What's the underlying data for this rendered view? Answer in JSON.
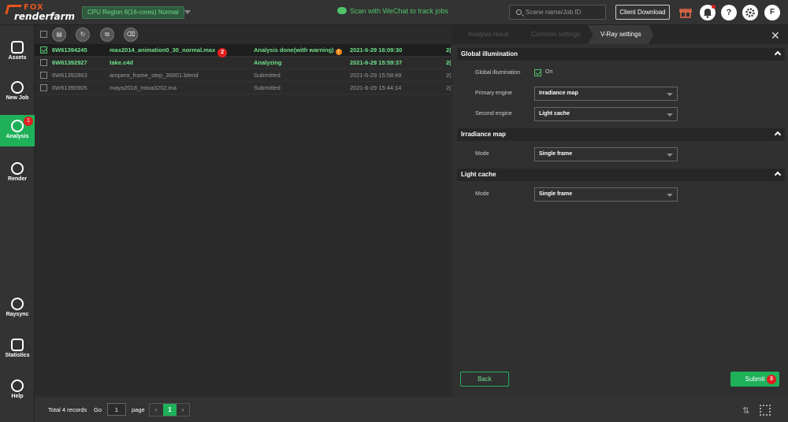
{
  "header": {
    "logo_top": "FOX",
    "logo_bottom": "renderfarm",
    "region": "CPU Region 6(16-cores)   Normal",
    "wechat": "Scan with WeChat to track jobs",
    "search_placeholder": "Scene name/Job ID",
    "client_download": "Client Download",
    "avatar": "F",
    "help": "?"
  },
  "sidebar": {
    "items": [
      {
        "label": "Assets"
      },
      {
        "label": "New Job"
      },
      {
        "label": "Analysis",
        "badge": "1"
      },
      {
        "label": "Render"
      },
      {
        "label": "Raysync"
      },
      {
        "label": "Statistics"
      },
      {
        "label": "Help"
      }
    ]
  },
  "jobs": [
    {
      "id": "6W61394245",
      "scene": "max2014_animation0_30_normal.max",
      "badge": "2",
      "status": "Analysis done(with warning)",
      "time": "2021-6-29 16:09:30",
      "extra": "2("
    },
    {
      "id": "6W61392927",
      "scene": "take.c4d",
      "status": "Analyzing",
      "time": "2021-6-29 15:59:37",
      "extra": "2("
    },
    {
      "id": "6W61392863",
      "scene": "ampera_frame_step_36001.blend",
      "status": "Submitted",
      "time": "2021-6-29 15:58:49",
      "extra": "2("
    },
    {
      "id": "6W61390905",
      "scene": "maya2018_mtoa3202.ma",
      "status": "Submitted",
      "time": "2021-6-29 15:44:14",
      "extra": "2("
    }
  ],
  "panel": {
    "tabs": [
      "Analysis result",
      "Common settings",
      "V-Ray settings"
    ],
    "sections": {
      "gi": {
        "title": "Global illumination",
        "gi_label": "Global illumination",
        "gi_on": "On",
        "primary_label": "Primary engine",
        "primary_value": "Irradiance map",
        "second_label": "Second engine",
        "second_value": "Light cache"
      },
      "irr": {
        "title": "Irradiance map",
        "mode_label": "Mode",
        "mode_value": "Single frame"
      },
      "lc": {
        "title": "Light cache",
        "mode_label": "Mode",
        "mode_value": "Single frame"
      }
    },
    "back": "Back",
    "submit": "Submit",
    "submit_badge": "3"
  },
  "footer": {
    "total": "Total 4 records",
    "go": "Go",
    "page_value": "1",
    "page": "page",
    "current_page": "1"
  }
}
